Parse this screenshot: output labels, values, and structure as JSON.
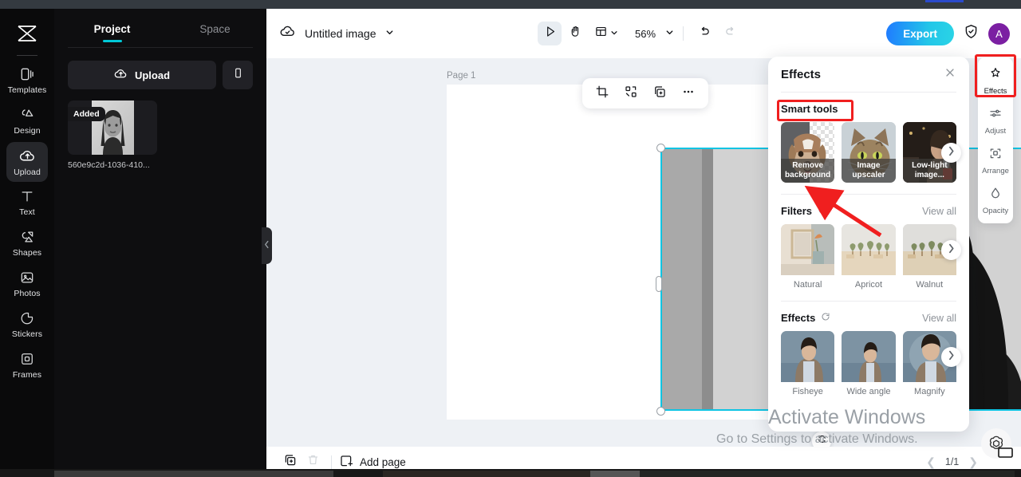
{
  "app": {
    "logo_icon": "capcut-logo-icon"
  },
  "rail": {
    "items": [
      {
        "label": "Templates",
        "icon": "templates-icon",
        "active": false
      },
      {
        "label": "Design",
        "icon": "design-icon",
        "active": false
      },
      {
        "label": "Upload",
        "icon": "upload-cloud-icon",
        "active": true
      },
      {
        "label": "Text",
        "icon": "text-icon",
        "active": false
      },
      {
        "label": "Shapes",
        "icon": "shapes-icon",
        "active": false
      },
      {
        "label": "Photos",
        "icon": "photos-icon",
        "active": false
      },
      {
        "label": "Stickers",
        "icon": "stickers-icon",
        "active": false
      },
      {
        "label": "Frames",
        "icon": "frames-icon",
        "active": false
      }
    ]
  },
  "panel": {
    "tabs": [
      {
        "label": "Project",
        "active": true
      },
      {
        "label": "Space",
        "active": false
      }
    ],
    "upload_label": "Upload",
    "upload_icon": "upload-cloud-icon",
    "mobile_icon": "mobile-phone-icon",
    "assets": [
      {
        "badge": "Added",
        "name": "560e9c2d-1036-410..."
      }
    ],
    "collapse_icon": "chevron-left-icon"
  },
  "topbar": {
    "cloud_icon": "cloud-check-icon",
    "title": "Untitled image",
    "title_caret": "chevron-down-icon",
    "tools": [
      {
        "name": "select-tool",
        "icon": "cursor-arrow-icon",
        "selected": true
      },
      {
        "name": "hand-tool",
        "icon": "hand-icon",
        "selected": false
      },
      {
        "name": "layout-tool",
        "icon": "layout-panel-icon",
        "selected": false
      }
    ],
    "zoom": "56%",
    "zoom_caret": "chevron-down-icon",
    "undo_icon": "undo-arrow-icon",
    "redo_icon": "redo-arrow-icon",
    "export_label": "Export",
    "shield_icon": "shield-check-icon",
    "avatar_initial": "A"
  },
  "canvas": {
    "page_label": "Page 1",
    "float_tools": [
      {
        "name": "crop-tool",
        "icon": "crop-icon"
      },
      {
        "name": "mask-tool",
        "icon": "mask-shapes-icon"
      },
      {
        "name": "duplicate-tool",
        "icon": "duplicate-icon"
      },
      {
        "name": "more-tool",
        "icon": "ellipsis-icon"
      }
    ],
    "rotate_icon": "rotate-icon"
  },
  "bottombar": {
    "duplicate_page_icon": "duplicate-page-icon",
    "delete_icon": "trash-icon",
    "add_page_label": "Add page",
    "add_page_icon": "add-page-icon",
    "prev_icon": "chevron-left-icon",
    "page_indicator": "1/1",
    "next_icon": "chevron-right-icon"
  },
  "effects_panel": {
    "title": "Effects",
    "close_icon": "close-icon",
    "sections": [
      {
        "title": "Smart tools",
        "refresh": false,
        "view_all": null,
        "caption_style": "inside",
        "cards": [
          {
            "label": "Remove background",
            "image": "dog-transparent-bg"
          },
          {
            "label": "Image upscaler",
            "image": "tabby-cat"
          },
          {
            "label": "Low-light image...",
            "image": "woman-drinking"
          }
        ]
      },
      {
        "title": "Filters",
        "refresh": true,
        "refresh_icon": "refresh-icon",
        "view_all": "View all",
        "caption_style": "below",
        "cards": [
          {
            "label": "Natural",
            "image": "vase-on-shelf"
          },
          {
            "label": "Apricot",
            "image": "desert-palms"
          },
          {
            "label": "Walnut",
            "image": "desert-palms-warm"
          }
        ]
      },
      {
        "title": "Effects",
        "refresh": true,
        "refresh_icon": "refresh-icon",
        "view_all": "View all",
        "caption_style": "below",
        "cards": [
          {
            "label": "Fisheye",
            "image": "man-by-sea"
          },
          {
            "label": "Wide angle",
            "image": "man-by-sea-wide"
          },
          {
            "label": "Magnify",
            "image": "man-by-sea-magnify"
          }
        ]
      }
    ],
    "next_icon": "chevron-right-icon"
  },
  "tool_rail": {
    "items": [
      {
        "label": "Effects",
        "icon": "magic-wand-icon",
        "active": true
      },
      {
        "label": "Adjust",
        "icon": "sliders-icon",
        "active": false
      },
      {
        "label": "Arrange",
        "icon": "arrange-icon",
        "active": false
      },
      {
        "label": "Opacity",
        "icon": "opacity-drop-icon",
        "active": false
      }
    ]
  },
  "watermark": {
    "line1": "Activate Windows",
    "line2": "Go to Settings to activate Windows."
  },
  "annotations": {
    "highlight_color": "#f01f1f",
    "arrow_from": "filters-section",
    "arrow_to": "remove-background-card"
  },
  "overlay": {
    "gpt_icon": "openai-logo-icon"
  }
}
